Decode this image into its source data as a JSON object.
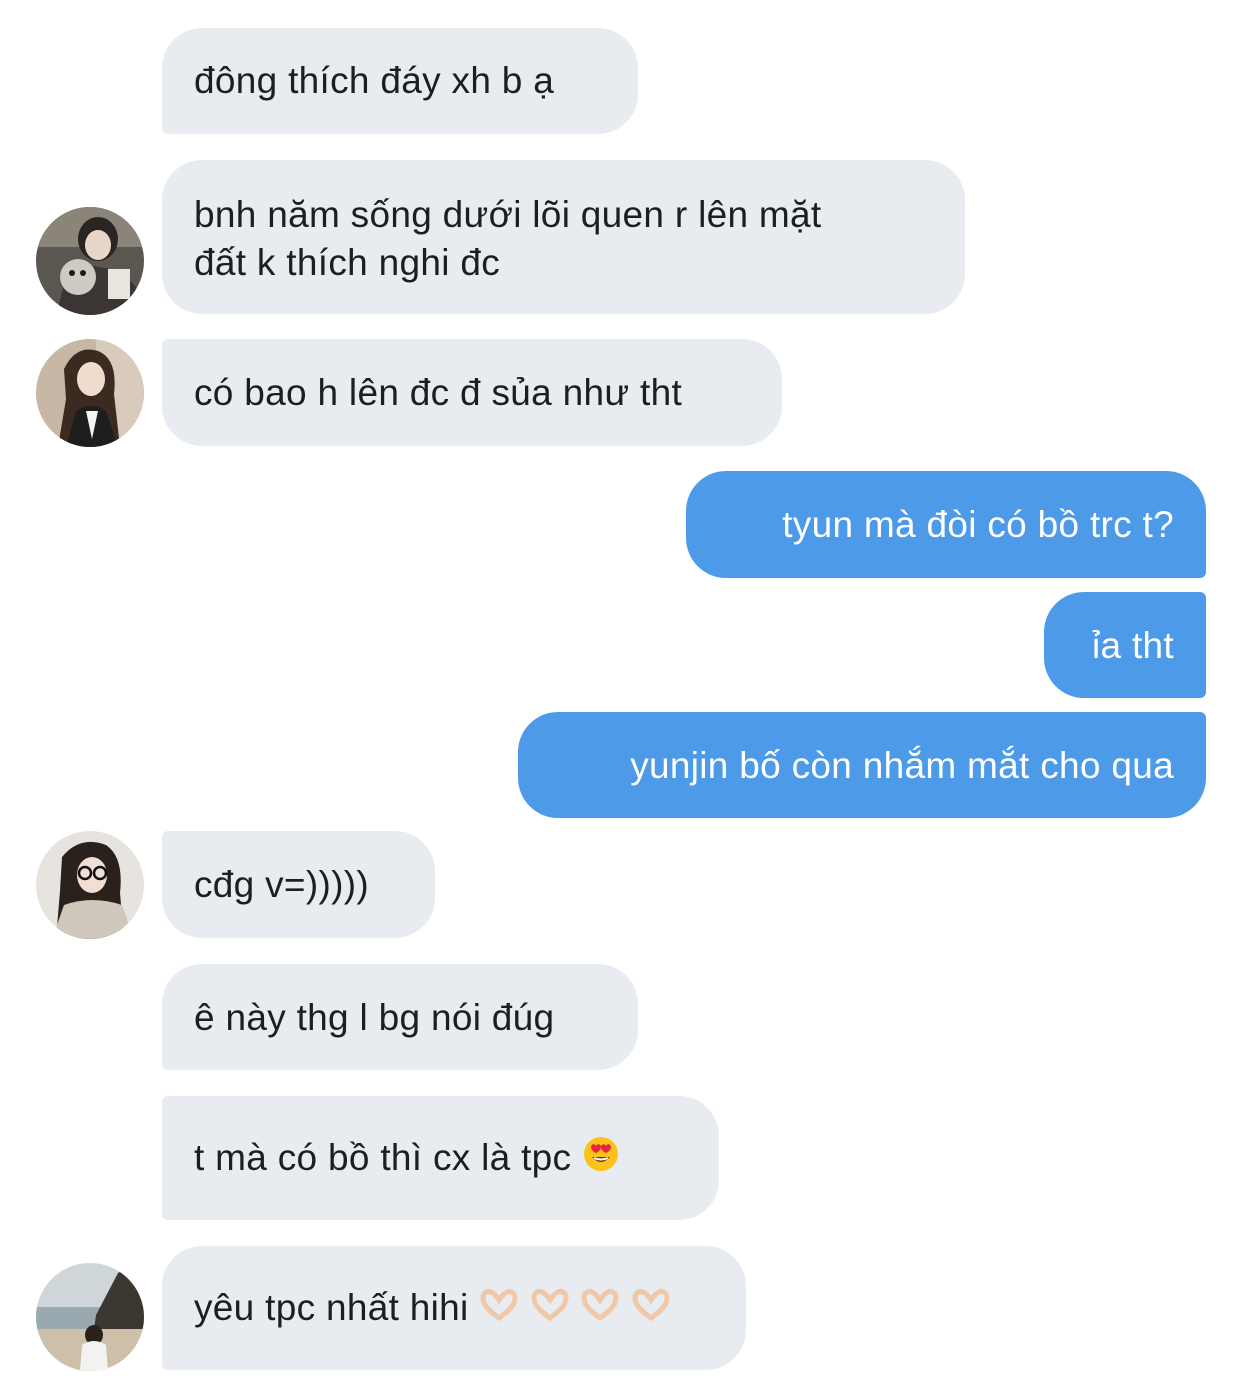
{
  "messages": [
    {
      "id": 1,
      "side": "in",
      "text": "đông thích đáy xh b ạ"
    },
    {
      "id": 2,
      "side": "in",
      "line1": "bnh năm sống dưới lõi quen r lên mặt",
      "line2": "đất k thích nghi đc",
      "avatar": "avatar-girl-with-dog"
    },
    {
      "id": 3,
      "side": "in",
      "text": "có bao h lên đc đ sủa như tht",
      "avatar": "avatar-girl-long-hair"
    },
    {
      "id": 4,
      "side": "out",
      "text": "tyun mà đòi có bồ trc t?"
    },
    {
      "id": 5,
      "side": "out",
      "text": "ỉa tht"
    },
    {
      "id": 6,
      "side": "out",
      "text": "yunjin bố còn nhắm mắt cho qua"
    },
    {
      "id": 7,
      "side": "in",
      "text": "cđg v=)))))",
      "avatar": "avatar-girl-glasses"
    },
    {
      "id": 8,
      "side": "in",
      "text": "ê này thg l bg nói đúg"
    },
    {
      "id": 9,
      "side": "in",
      "text": "t mà có bồ thì cx là tpc",
      "emoji": "heart-eyes-emoji"
    },
    {
      "id": 10,
      "side": "in",
      "text": "yêu tpc nhất hihi",
      "emoji": "heart-hands-emoji",
      "emoji_count": 4,
      "avatar": "avatar-person-beach"
    }
  ],
  "colors": {
    "incoming_bubble": "#e8ebef",
    "incoming_text": "#1c1e21",
    "outgoing_bubble": "#4c9ae8",
    "outgoing_text": "#ffffff"
  }
}
